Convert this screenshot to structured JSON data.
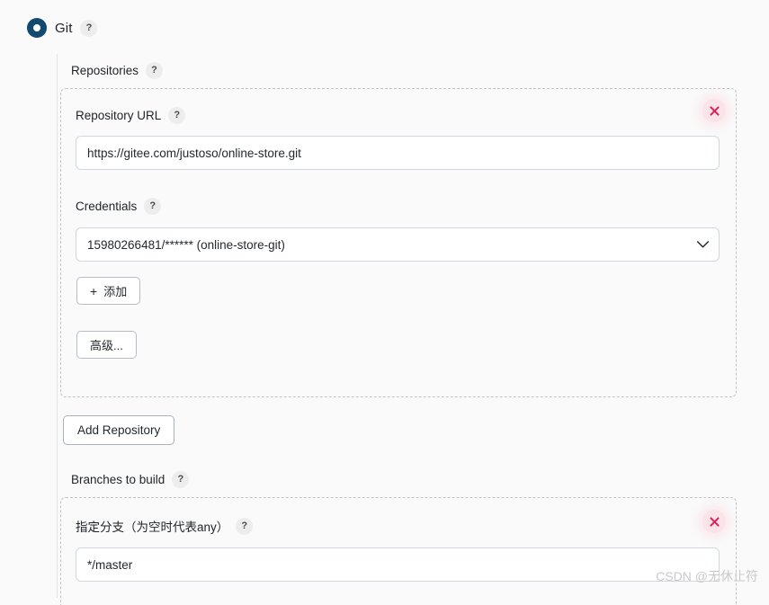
{
  "scm": {
    "selected_label": "Git",
    "help_glyph": "?",
    "radio_color": "#12496e"
  },
  "repositories": {
    "section_label": "Repositories",
    "repo": {
      "url_label": "Repository URL",
      "url_value": "https://gitee.com/justoso/online-store.git",
      "url_placeholder": "",
      "credentials_label": "Credentials",
      "credentials_value": "15980266481/****** (online-store-git)",
      "add_credentials_label": "添加",
      "add_credentials_plus": "+",
      "advanced_label": "高级...",
      "remove_icon": "close-x-icon"
    },
    "add_repository_label": "Add Repository"
  },
  "branches": {
    "section_label": "Branches to build",
    "branch": {
      "specifier_label": "指定分支（为空时代表any）",
      "specifier_value": "*/master",
      "specifier_placeholder": "",
      "remove_icon": "close-x-icon"
    }
  },
  "watermark": {
    "text": "CSDN @无休止符"
  }
}
